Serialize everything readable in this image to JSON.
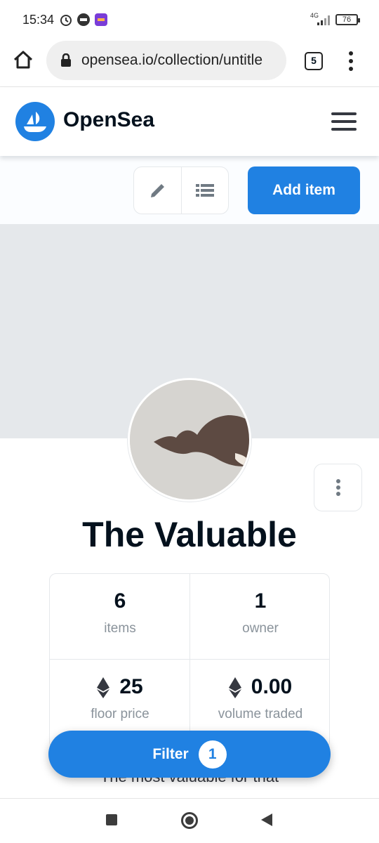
{
  "status_bar": {
    "time": "15:34",
    "network": "4G",
    "battery": "76"
  },
  "browser": {
    "url": "opensea.io/collection/untitle",
    "tab_count": "5"
  },
  "header": {
    "brand": "OpenSea"
  },
  "actions": {
    "add_item_label": "Add item"
  },
  "collection": {
    "title": "The Valuable",
    "stats": [
      {
        "value": "6",
        "label": "items"
      },
      {
        "value": "1",
        "label": "owner"
      },
      {
        "value": "25",
        "label": "floor price",
        "currency_icon": "ethereum-icon"
      },
      {
        "value": "0.00",
        "label": "volume traded",
        "currency_icon": "ethereum-icon"
      }
    ],
    "description_partial": "The most valuable for that"
  },
  "filter": {
    "label": "Filter",
    "count": "1"
  },
  "colors": {
    "accent": "#2081e2",
    "text": "#04111d",
    "muted": "#8a939b",
    "banner": "#e5e8eb"
  }
}
